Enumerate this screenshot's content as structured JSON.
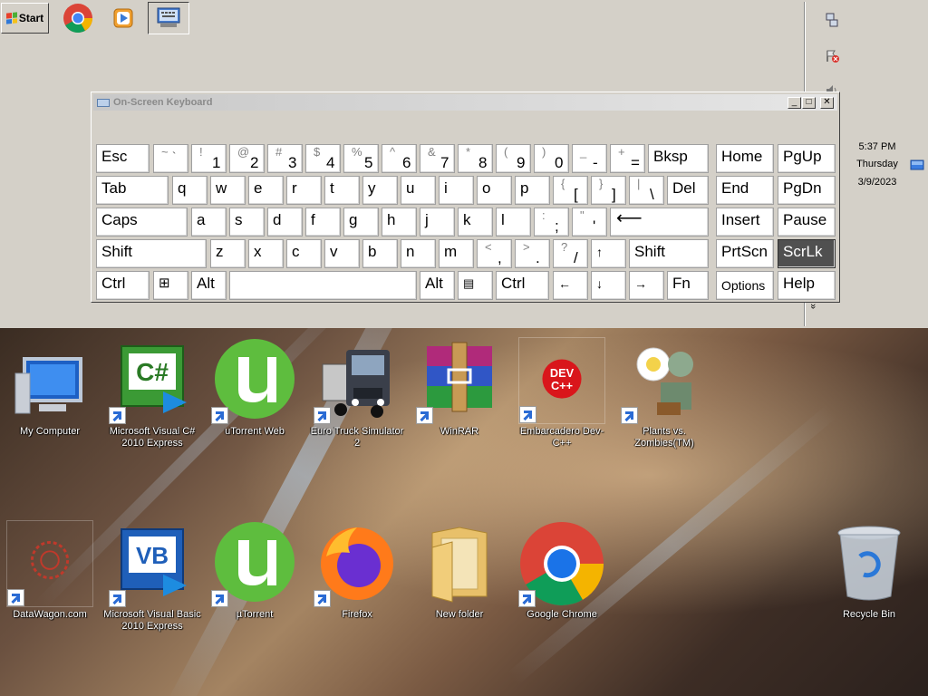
{
  "taskbar": {
    "start_label": "Start",
    "quick_launch": [
      {
        "name": "chrome-icon"
      },
      {
        "name": "media-player-icon"
      },
      {
        "name": "on-screen-keyboard-icon"
      }
    ]
  },
  "tray": {
    "time": "5:37 PM",
    "day": "Thursday",
    "date": "3/9/2023",
    "expand_label": "»"
  },
  "osk": {
    "title": "On-Screen Keyboard",
    "keys": {
      "esc": "Esc",
      "tilde_up": "~",
      "tilde_lo": "`",
      "k1_up": "!",
      "k1_lo": "1",
      "k2_up": "@",
      "k2_lo": "2",
      "k3_up": "#",
      "k3_lo": "3",
      "k4_up": "$",
      "k4_lo": "4",
      "k5_up": "%",
      "k5_lo": "5",
      "k6_up": "^",
      "k6_lo": "6",
      "k7_up": "&",
      "k7_lo": "7",
      "k8_up": "*",
      "k8_lo": "8",
      "k9_up": "(",
      "k9_lo": "9",
      "k0_up": ")",
      "k0_lo": "0",
      "minus_up": "_",
      "minus_lo": "-",
      "eq_up": "+",
      "eq_lo": "=",
      "bksp": "Bksp",
      "home": "Home",
      "pgup": "PgUp",
      "tab": "Tab",
      "q": "q",
      "w": "w",
      "e": "e",
      "r": "r",
      "t": "t",
      "y": "y",
      "u": "u",
      "i": "i",
      "o": "o",
      "p": "p",
      "lbr_up": "{",
      "lbr_lo": "[",
      "rbr_up": "}",
      "rbr_lo": "]",
      "bsl_up": "|",
      "bsl_lo": "\\",
      "del": "Del",
      "end": "End",
      "pgdn": "PgDn",
      "caps": "Caps",
      "a": "a",
      "s": "s",
      "d": "d",
      "f": "f",
      "g": "g",
      "h": "h",
      "j": "j",
      "k": "k",
      "l": "l",
      "semi_up": ":",
      "semi_lo": ";",
      "quote_up": "\"",
      "quote_lo": "'",
      "enter": "⟵",
      "insert": "Insert",
      "pause": "Pause",
      "shift": "Shift",
      "z": "z",
      "x": "x",
      "c": "c",
      "v": "v",
      "b": "b",
      "n": "n",
      "m": "m",
      "comma_up": "<",
      "comma_lo": ",",
      "period_up": ">",
      "period_lo": ".",
      "slash_up": "?",
      "slash_lo": "/",
      "up_arrow": "↑",
      "shift_r": "Shift",
      "prtscn": "PrtScn",
      "scrlk": "ScrLk",
      "ctrl": "Ctrl",
      "win": "⊞",
      "alt": "Alt",
      "alt_r": "Alt",
      "menu": "▤",
      "ctrl_r": "Ctrl",
      "left_arrow": "←",
      "down_arrow": "↓",
      "right_arrow": "→",
      "fn": "Fn",
      "options": "Options",
      "help": "Help"
    }
  },
  "desktop_icons": [
    {
      "label": "My Computer"
    },
    {
      "label": "Microsoft Visual C# 2010 Express"
    },
    {
      "label": "uTorrent Web"
    },
    {
      "label": "Euro Truck Simulator 2"
    },
    {
      "label": "WinRAR"
    },
    {
      "label": "Embarcadero Dev-C++"
    },
    {
      "label": "Plants vs. Zombies(TM)"
    },
    {
      "label": "DataWagon.com"
    },
    {
      "label": "Microsoft Visual Basic 2010 Express"
    },
    {
      "label": "µTorrent"
    },
    {
      "label": "Firefox"
    },
    {
      "label": "New folder"
    },
    {
      "label": "Google Chrome"
    },
    {
      "label": "Recycle Bin"
    }
  ],
  "icon_text": {
    "csharp": "C#",
    "vb": "VB",
    "dev": "DEV",
    "cpp": "C++"
  },
  "colors": {
    "chrome_accent": "#1a73e8",
    "utorrent_green": "#5ebd3e",
    "active_key": "#505050"
  }
}
